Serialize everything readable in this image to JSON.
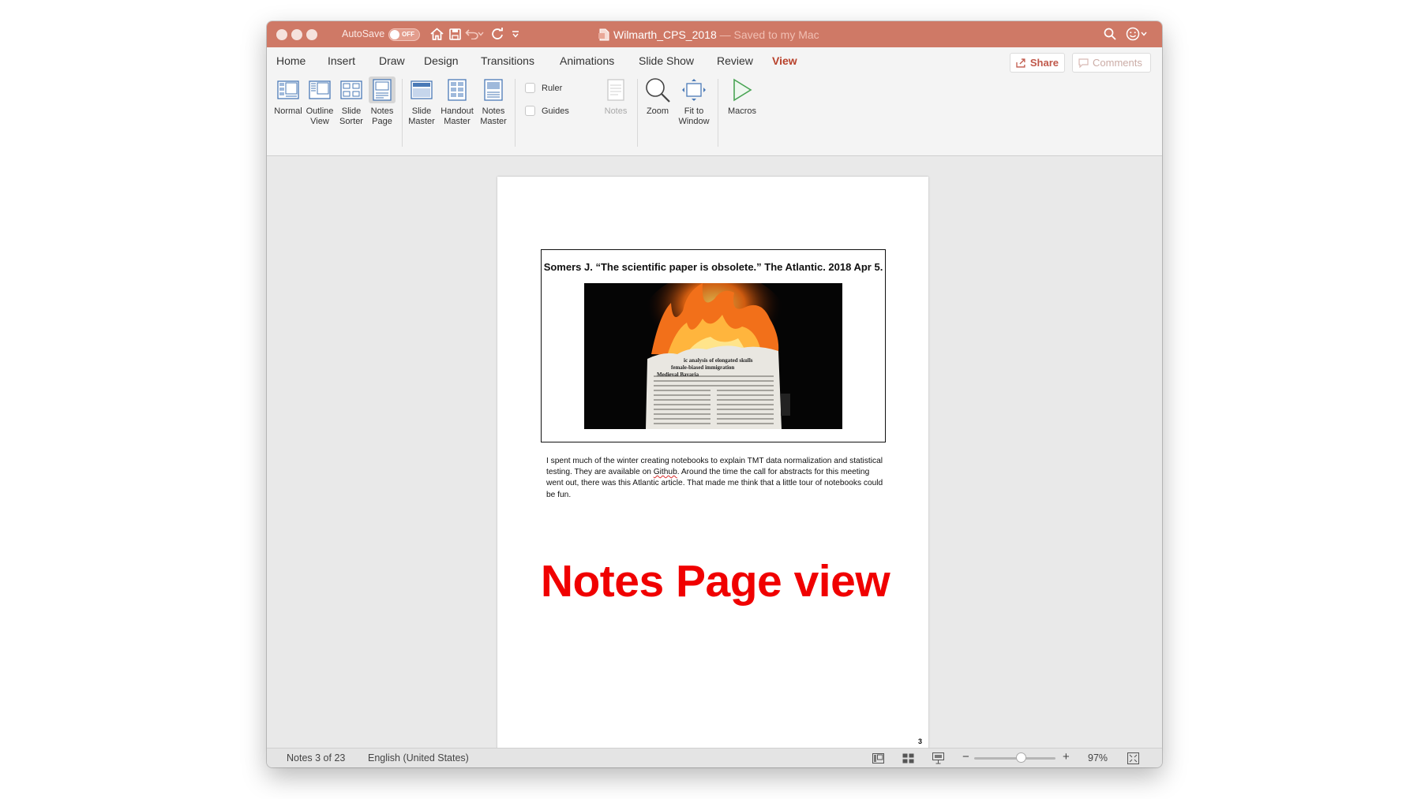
{
  "titlebar": {
    "autosave_label": "AutoSave",
    "autosave_state": "OFF",
    "doc_name": "Wilmarth_CPS_2018",
    "doc_status": "— Saved to my Mac"
  },
  "tabs": [
    "Home",
    "Insert",
    "Draw",
    "Design",
    "Transitions",
    "Animations",
    "Slide Show",
    "Review",
    "View"
  ],
  "active_tab": "View",
  "share_label": "Share",
  "comments_label": "Comments",
  "ribbon": {
    "normal": "Normal",
    "outline_view": [
      "Outline",
      "View"
    ],
    "slide_sorter": [
      "Slide",
      "Sorter"
    ],
    "notes_page": [
      "Notes",
      "Page"
    ],
    "slide_master": [
      "Slide",
      "Master"
    ],
    "handout_master": [
      "Handout",
      "Master"
    ],
    "notes_master": [
      "Notes",
      "Master"
    ],
    "ruler": "Ruler",
    "guides": "Guides",
    "notes": "Notes",
    "zoom": "Zoom",
    "fit_to_window": [
      "Fit to",
      "Window"
    ],
    "macros": "Macros"
  },
  "page": {
    "slide_title": "Somers J. “The scientific paper is obsolete.” The Atlantic. 2018 Apr 5.",
    "image_caption_lines": [
      "ic analysis of elongated skulls",
      "female-biased immigration",
      "Medieval Bavaria"
    ],
    "notes_before": "I spent much of the winter creating notebooks to explain TMT data normalization and statistical testing. They are available on ",
    "notes_link": "Github",
    "notes_after": ". Around the time the call for abstracts for this meeting went out, there was this Atlantic article. That made me think that a little tour of notebooks could be fun.",
    "page_number": "3",
    "overlay_label": "Notes Page view"
  },
  "statusbar": {
    "position": "Notes 3 of 23",
    "language": "English (United States)",
    "zoom": "97%"
  },
  "colors": {
    "titlebar": "#cf7966",
    "accent": "#b8412b",
    "overlay_label": "#f00000"
  }
}
